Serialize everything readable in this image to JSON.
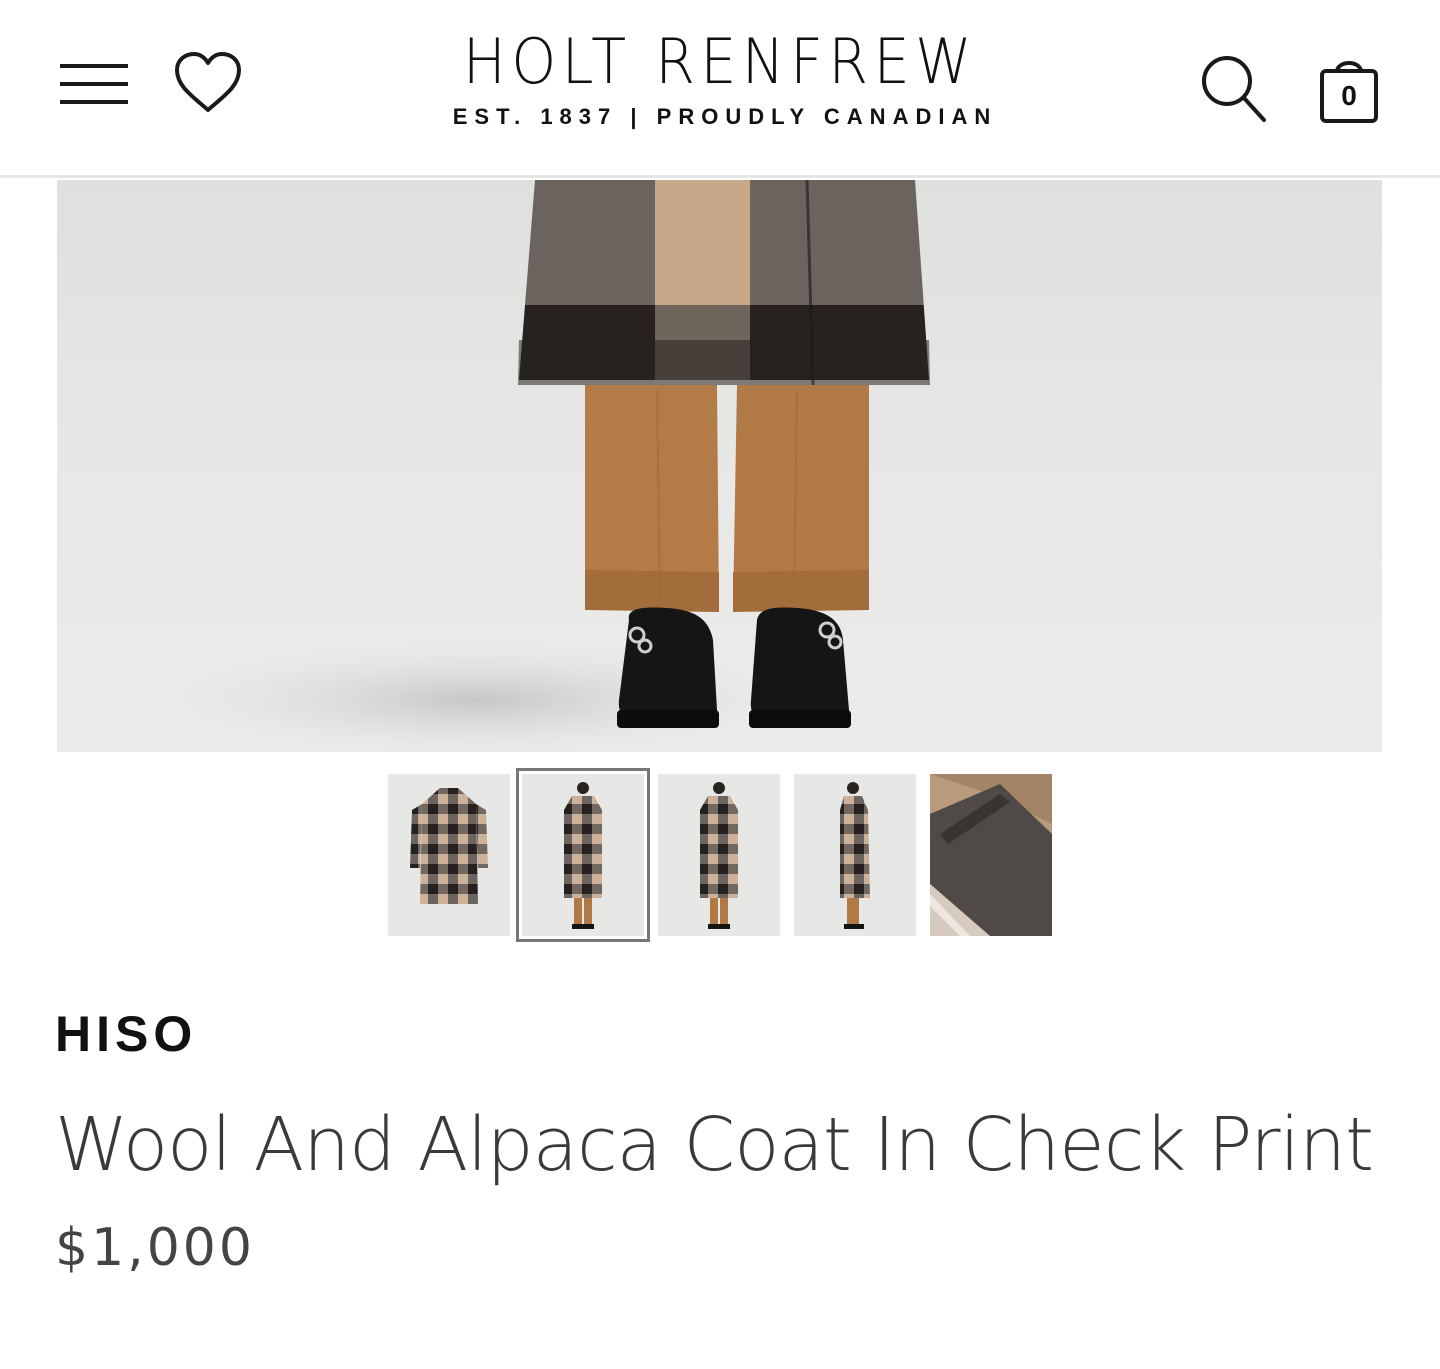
{
  "header": {
    "logo_title": "HOLT RENFREW",
    "logo_tagline": "EST. 1837 | PROUDLY CANADIAN",
    "bag_count": "0",
    "icons": {
      "menu": "hamburger-menu-icon",
      "wishlist": "heart-icon",
      "search": "search-icon",
      "bag": "shopping-bag-icon"
    }
  },
  "gallery": {
    "selected_index": 1,
    "thumbnails": [
      {
        "view": "coat-only"
      },
      {
        "view": "model-front"
      },
      {
        "view": "model-back"
      },
      {
        "view": "model-side"
      },
      {
        "view": "fabric-detail"
      }
    ]
  },
  "product": {
    "brand": "HISO",
    "name": "Wool And Alpaca Coat In Check Print",
    "price": "$1,000"
  },
  "colors": {
    "check_dark": "#2b2623",
    "check_tan": "#c4a587",
    "check_grey": "#6e6660",
    "pants": "#b07a46",
    "background": "#e4e4e2"
  }
}
